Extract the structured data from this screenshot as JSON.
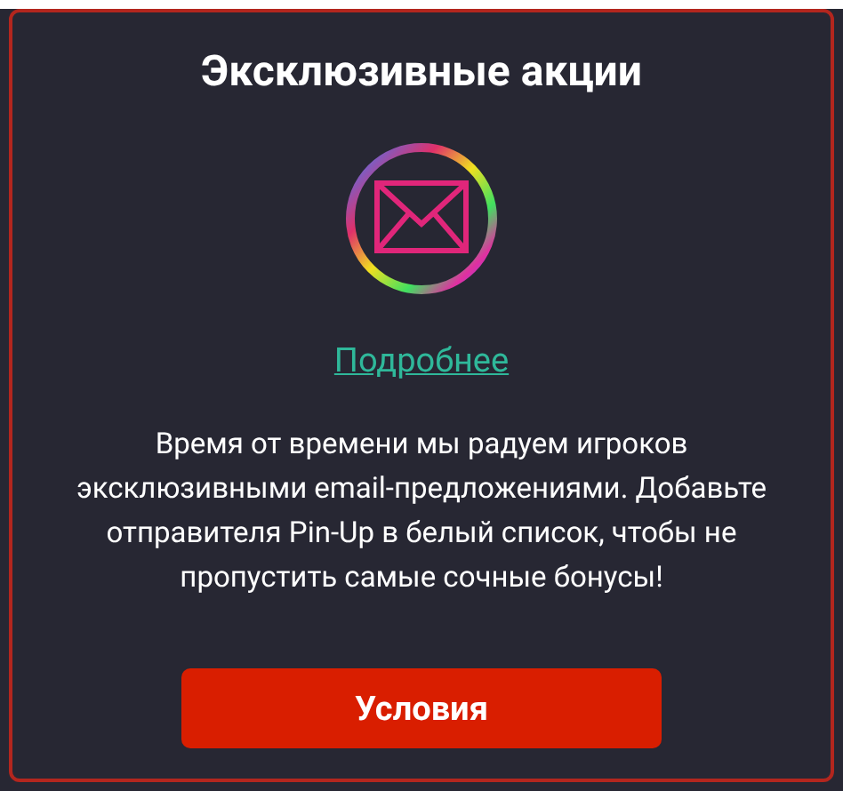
{
  "title": "Эксклюзивные акции",
  "link": "Подробнее",
  "description": "Время от времени мы радуем игроков эксклюзивными email-предложениями. Добавьте отправителя Pin-Up в белый список, чтобы не пропустить самые сочные бонусы!",
  "button": "Условия"
}
